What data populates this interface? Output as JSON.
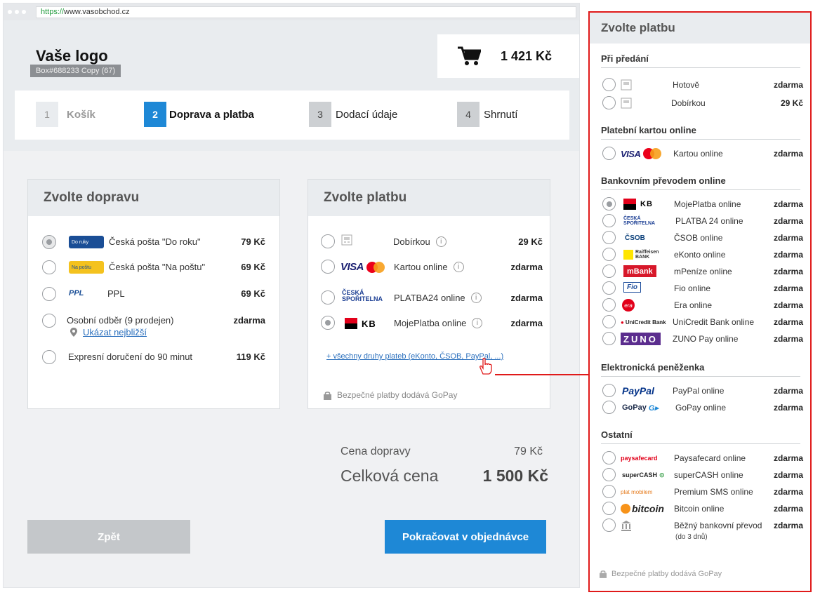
{
  "browser": {
    "url_proto": "https://",
    "url_rest": "www.vasobchod.cz"
  },
  "header": {
    "logo": "Vaše logo",
    "badge": "Box#688233 Copy (67)",
    "cart_total": "1 421 Kč"
  },
  "steps": [
    {
      "num": "1",
      "label": "Košík"
    },
    {
      "num": "2",
      "label": "Doprava a platba"
    },
    {
      "num": "3",
      "label": "Dodací údaje"
    },
    {
      "num": "4",
      "label": "Shrnutí"
    }
  ],
  "shipping": {
    "title": "Zvolte dopravu",
    "options": [
      {
        "label": "Česká pošta \"Do roku\"",
        "price": "79 Kč",
        "icon": "ceska-posta-icon",
        "icon_text": "Do ruky"
      },
      {
        "label": "Česká pošta \"Na poštu\"",
        "price": "69 Kč",
        "icon": "ceska-posta-icon",
        "icon_text": "Na poštu"
      },
      {
        "label": "PPL",
        "price": "69 Kč",
        "icon": "ppl-icon",
        "icon_text": "PPL"
      },
      {
        "label": "Osobní odběr (9 prodejen)",
        "price": "zdarma",
        "link": "Ukázat nejbližší"
      },
      {
        "label": "Expresní doručení do 90 minut",
        "price": "119 Kč"
      }
    ]
  },
  "payment": {
    "title": "Zvolte platbu",
    "options": [
      {
        "label": "Dobírkou",
        "price": "29 Kč"
      },
      {
        "label": "Kartou online",
        "price": "zdarma",
        "icon_text": "VISA"
      },
      {
        "label": "PLATBA24 online",
        "price": "zdarma",
        "icon_text": "ČESKÁ SPOŘITELNA"
      },
      {
        "label": "MojePlatba online",
        "price": "zdarma",
        "icon_text": "KB"
      }
    ],
    "more_link": "+ všechny druhy plateb (eKonto, ČSOB, PayPal, ...)",
    "secure": "Bezpečné platby dodává GoPay"
  },
  "summary": {
    "shipping_label": "Cena dopravy",
    "shipping_value": "79 Kč",
    "total_label": "Celková cena",
    "total_value": "1 500 Kč"
  },
  "buttons": {
    "back": "Zpět",
    "next": "Pokračovat v objednávce"
  },
  "expanded": {
    "title": "Zvolte platbu",
    "sections": [
      {
        "title": "Při předání"
      },
      {
        "title": "Platební kartou online"
      },
      {
        "title": "Bankovním převodem online"
      },
      {
        "title": "Elektronická peněženka"
      },
      {
        "title": "Ostatní"
      }
    ],
    "rows": [
      {
        "label": "Hotově",
        "price": "zdarma"
      },
      {
        "label": "Dobírkou",
        "price": "29 Kč"
      },
      {
        "label": "Kartou online",
        "price": "zdarma"
      },
      {
        "label": "MojePlatba online",
        "price": "zdarma"
      },
      {
        "label": "PLATBA 24 online",
        "price": "zdarma"
      },
      {
        "label": "ČSOB online",
        "price": "zdarma"
      },
      {
        "label": "eKonto online",
        "price": "zdarma"
      },
      {
        "label": "mPeníze online",
        "price": "zdarma"
      },
      {
        "label": "Fio online",
        "price": "zdarma"
      },
      {
        "label": "Era online",
        "price": "zdarma"
      },
      {
        "label": "UniCredit Bank online",
        "price": "zdarma"
      },
      {
        "label": "ZUNO Pay online",
        "price": "zdarma"
      },
      {
        "label": "PayPal online",
        "price": "zdarma"
      },
      {
        "label": "GoPay online",
        "price": "zdarma"
      },
      {
        "label": "Paysafecard online",
        "price": "zdarma"
      },
      {
        "label": "superCASH online",
        "price": "zdarma"
      },
      {
        "label": "Premium SMS online",
        "price": "zdarma"
      },
      {
        "label": "Bitcoin online",
        "price": "zdarma"
      },
      {
        "label": "Běžný bankovní převod",
        "price": "zdarma",
        "sub": "(do 3 dnů)"
      }
    ],
    "logos": {
      "visa": "VISA",
      "kb": "KB",
      "cs": "ČESKÁ SPOŘITELNA",
      "csob": "ČSOB",
      "raiffeisen": "Raiffeisen BANK",
      "mbank": "mBank",
      "fio": "Fio",
      "era": "era",
      "unicredit": "UniCredit Bank",
      "zuno": "ZUNO",
      "paypal": "PayPal",
      "gopay": "GoPay",
      "paysafe": "paysafecard",
      "supercash": "superCASH",
      "platmobilem": "plat mobilem",
      "bitcoin": "bitcoin"
    },
    "secure": "Bezpečné platby dodává GoPay"
  }
}
